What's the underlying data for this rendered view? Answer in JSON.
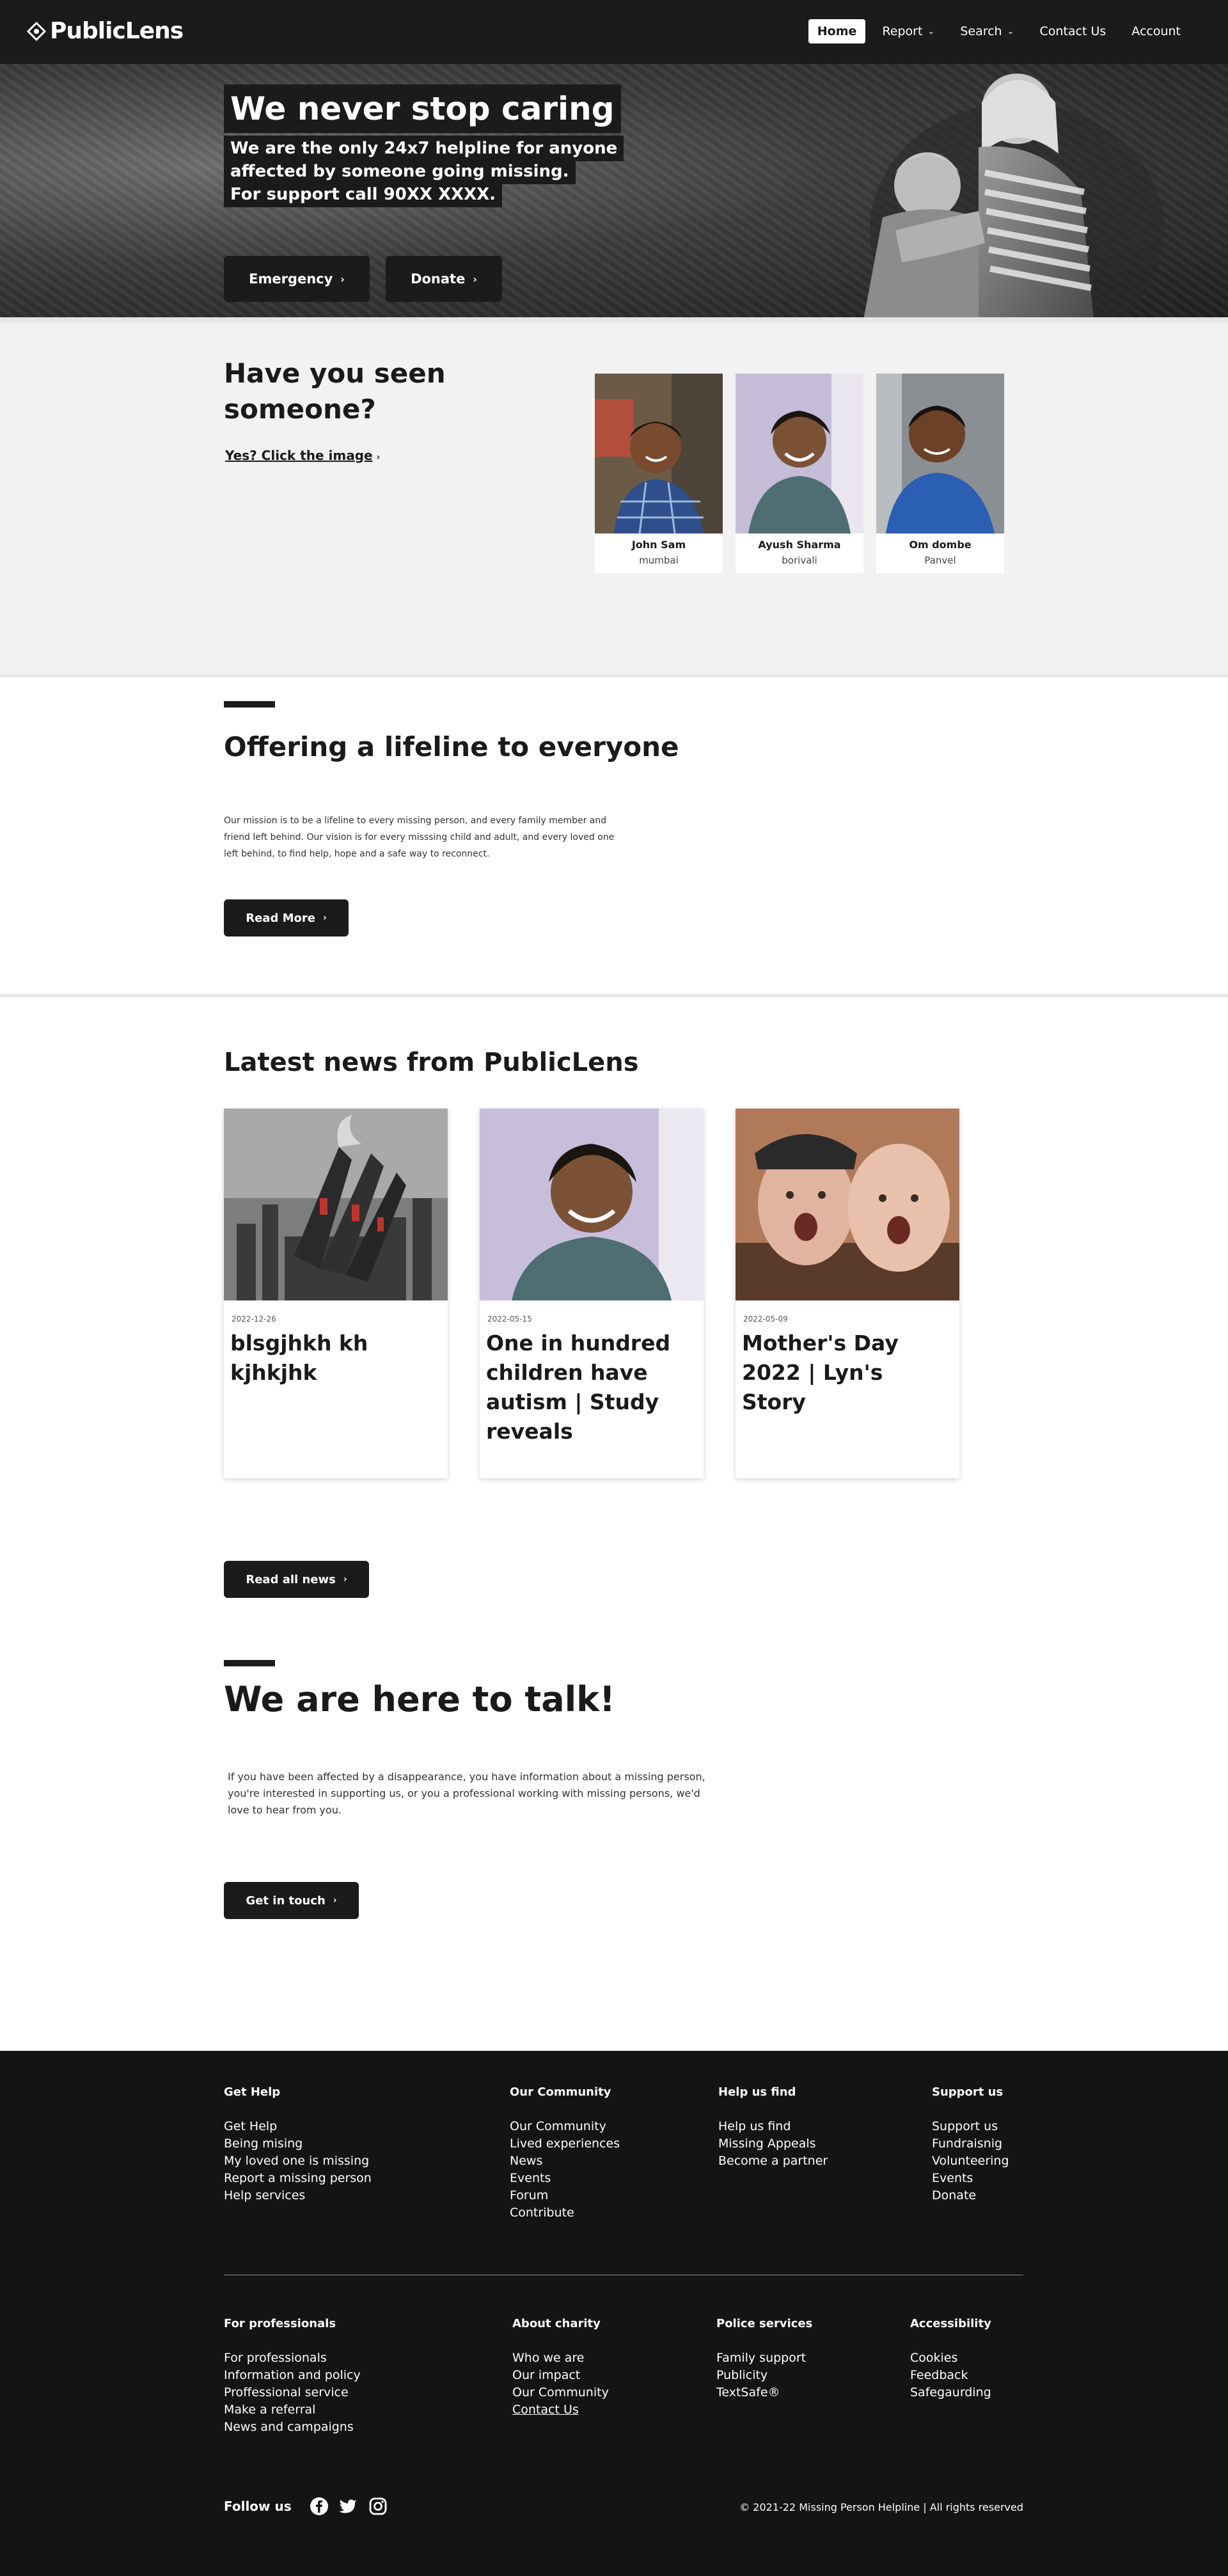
{
  "nav": {
    "logo": "PublicLens",
    "items": [
      {
        "label": "Home",
        "active": true,
        "dropdown": false
      },
      {
        "label": "Report",
        "active": false,
        "dropdown": true
      },
      {
        "label": "Search",
        "active": false,
        "dropdown": true
      },
      {
        "label": "Contact Us",
        "active": false,
        "dropdown": false
      },
      {
        "label": "Account",
        "active": false,
        "dropdown": false
      }
    ]
  },
  "hero": {
    "title": "We never stop caring",
    "lines": [
      "We are the only 24x7 helpline for anyone",
      "affected by someone going missing.",
      "For support call 90XX XXXX."
    ],
    "buttons": [
      "Emergency",
      "Donate"
    ]
  },
  "seen": {
    "title": "Have you seen someone?",
    "link": "Yes? Click the image",
    "people": [
      {
        "name": "John Sam",
        "location": "mumbai"
      },
      {
        "name": "Ayush Sharma",
        "location": "borivali"
      },
      {
        "name": "Om dombe",
        "location": "Panvel"
      }
    ]
  },
  "mission": {
    "title": "Offering a lifeline to everyone",
    "text": "Our mission is to be a lifeline to every missing person, and every family member and friend left behind. Our vision is for every misssing child and adult, and every loved one left behind, to find help, hope and a safe way to reconnect.",
    "button": "Read More"
  },
  "news": {
    "title": "Latest news from PublicLens",
    "articles": [
      {
        "date": "2022-12-26",
        "headline": "blsgjhkh kh kjhkjhk"
      },
      {
        "date": "2022-05-15",
        "headline": "One in hundred children have autism | Study reveals"
      },
      {
        "date": "2022-05-09",
        "headline": "Mother's Day 2022 | Lyn's Story"
      }
    ],
    "button": "Read all news"
  },
  "talk": {
    "title": "We are here to talk!",
    "text": "If you have been affected by a disappearance, you have information about a missing person, you're interested in supporting us, or you a professional working with missing persons, we'd love to hear from you.",
    "button": "Get in touch"
  },
  "footer": {
    "columns_top": [
      {
        "heading": "Get Help",
        "links": [
          "Get Help",
          "Being mising",
          "My loved one is missing",
          "Report a missing person",
          "Help services"
        ]
      },
      {
        "heading": "Our Community",
        "links": [
          "Our Community",
          "Lived experiences",
          "News",
          "Events",
          "Forum",
          "Contribute"
        ]
      },
      {
        "heading": "Help us find",
        "links": [
          "Help us find",
          "Missing Appeals",
          "Become a partner"
        ]
      },
      {
        "heading": "Support us",
        "links": [
          "Support us",
          "Fundraisnig",
          "Volunteering",
          "Events",
          "Donate"
        ]
      }
    ],
    "columns_bottom": [
      {
        "heading": "For professionals",
        "links": [
          "For professionals",
          "Information and policy",
          "Proffessional service",
          "Make a referral",
          "News and campaigns"
        ]
      },
      {
        "heading": "About charity",
        "links": [
          "Who we are",
          "Our impact",
          "Our Community",
          "Contact Us"
        ]
      },
      {
        "heading": "Police services",
        "links": [
          "Family support",
          "Publicity",
          "TextSafe®"
        ]
      },
      {
        "heading": "Accessibility",
        "links": [
          "Cookies",
          "Feedback",
          "Safegaurding"
        ]
      }
    ],
    "follow": "Follow us",
    "social_icons": [
      "facebook-icon",
      "twitter-icon",
      "instagram-icon"
    ],
    "copyright": "© 2021-22 Missing Person Helpline | All rights reserved"
  }
}
